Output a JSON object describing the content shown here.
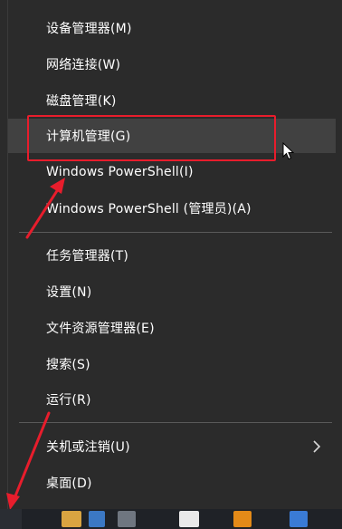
{
  "menu": {
    "items": [
      {
        "label": "设备管理器(M)"
      },
      {
        "label": "网络连接(W)"
      },
      {
        "label": "磁盘管理(K)"
      },
      {
        "label": "计算机管理(G)",
        "selected": true
      },
      {
        "label": "Windows PowerShell(I)"
      },
      {
        "label": "Windows PowerShell (管理员)(A)"
      },
      {
        "label": "任务管理器(T)"
      },
      {
        "label": "设置(N)"
      },
      {
        "label": "文件资源管理器(E)"
      },
      {
        "label": "搜索(S)"
      },
      {
        "label": "运行(R)"
      },
      {
        "label": "关机或注销(U)",
        "has_submenu": true
      },
      {
        "label": "桌面(D)"
      }
    ]
  },
  "colors": {
    "menu_background": "#2b2b2b",
    "selected_background": "#414141",
    "text": "#ffffff",
    "separator": "#5a5a5a",
    "annotation_red": "#e81d2c",
    "taskbar": "#1f2227"
  },
  "icons": {
    "submenu_arrow": "chevron-right-icon",
    "cursor": "mouse-pointer-icon"
  }
}
